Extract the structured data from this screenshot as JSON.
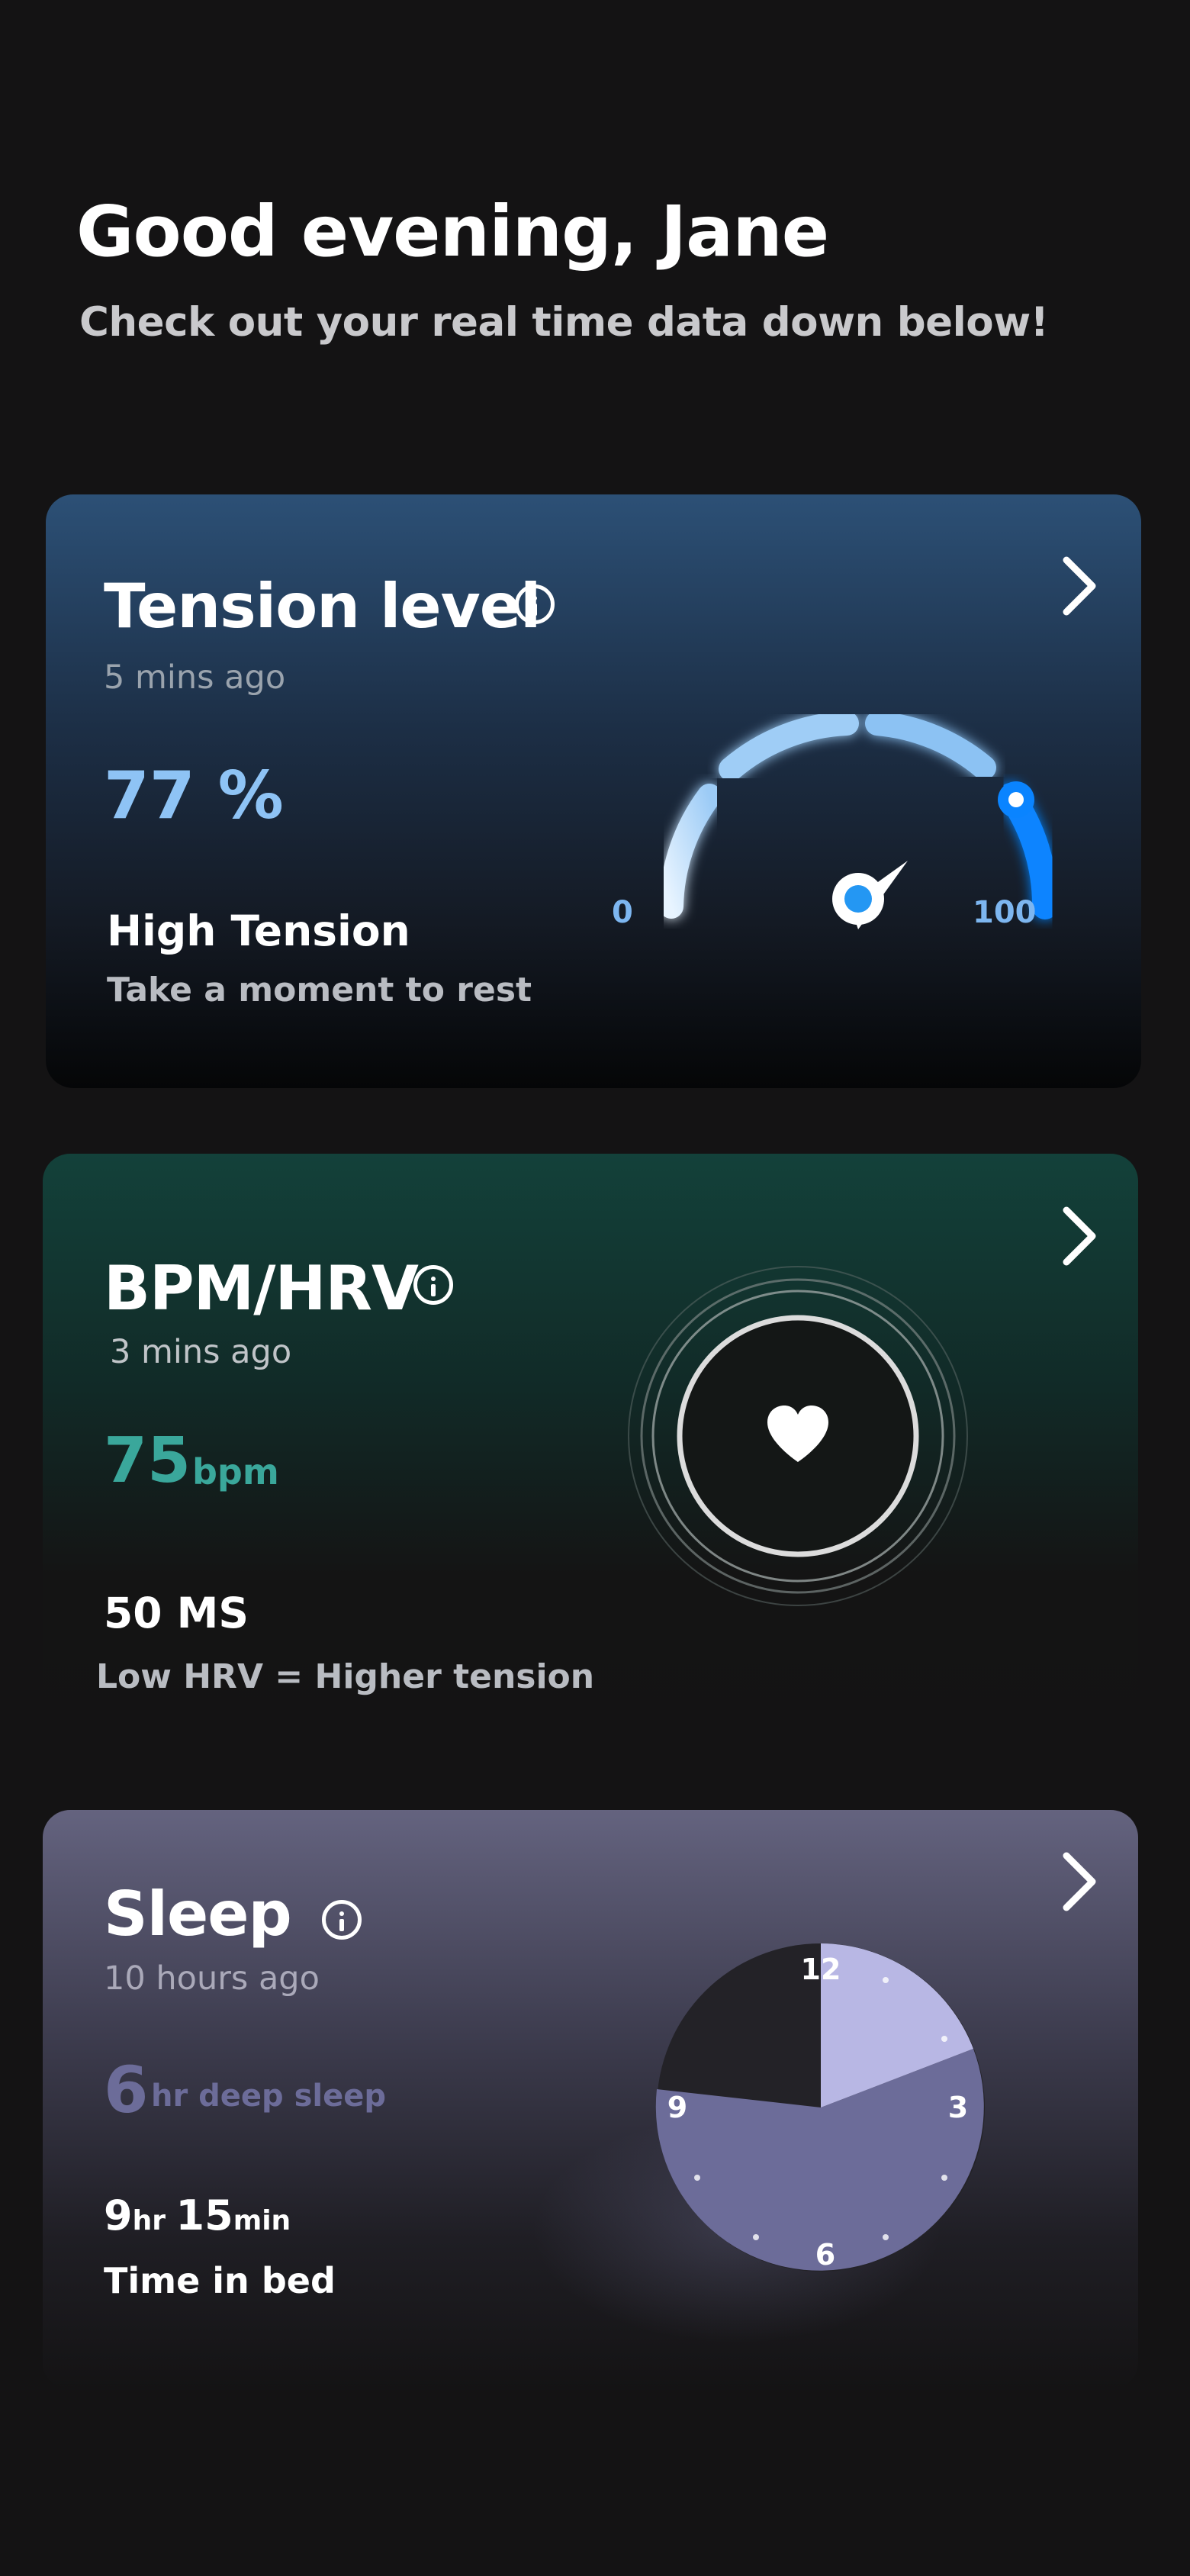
{
  "greeting": "Good evening, Jane",
  "subtitle": "Check out your real time data down below!",
  "tension": {
    "title": "Tension level",
    "updated": "5 mins ago",
    "value": "77 %",
    "level_percent": 77,
    "status": "High Tension",
    "advice": "Take a moment to rest",
    "gauge_min": "0",
    "gauge_max": "100",
    "accent_color": "#8ec3f5"
  },
  "bpm": {
    "title": "BPM/HRV",
    "updated": "3 mins ago",
    "value": "75",
    "unit": "bpm",
    "hrv": "50 MS",
    "note": "Low HRV =  Higher tension",
    "accent_color": "#3aa79b"
  },
  "sleep": {
    "title": "Sleep",
    "updated": "10 hours ago",
    "deep_value": "6",
    "deep_label": "hr deep sleep",
    "bed_hours": "9",
    "bed_hours_unit": "hr",
    "bed_minutes": "15",
    "bed_minutes_unit": "min",
    "bed_label": "Time in bed",
    "clock_labels": {
      "twelve": "12",
      "three": "3",
      "six": "6",
      "nine": "9"
    },
    "accent_color": "#6c6c99"
  },
  "icons": {
    "info": "info-icon",
    "chevron": "chevron-right-icon",
    "heart": "heart-icon"
  }
}
